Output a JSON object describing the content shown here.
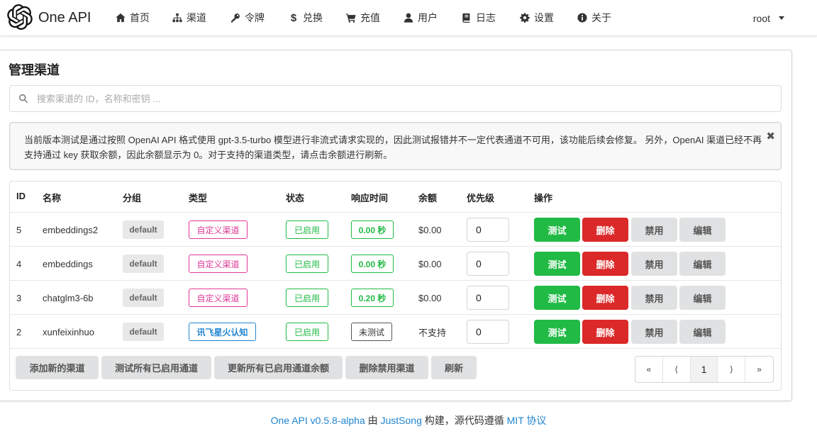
{
  "app": {
    "name": "One API"
  },
  "nav": [
    {
      "label": "首页",
      "icon": "home-icon"
    },
    {
      "label": "渠道",
      "icon": "sitemap-icon"
    },
    {
      "label": "令牌",
      "icon": "key-icon"
    },
    {
      "label": "兑换",
      "icon": "dollar-icon"
    },
    {
      "label": "充值",
      "icon": "cart-icon"
    },
    {
      "label": "用户",
      "icon": "user-icon"
    },
    {
      "label": "日志",
      "icon": "book-icon"
    },
    {
      "label": "设置",
      "icon": "gear-icon"
    },
    {
      "label": "关于",
      "icon": "info-icon"
    }
  ],
  "user": {
    "name": "root"
  },
  "page": {
    "title": "管理渠道"
  },
  "search": {
    "placeholder": "搜索渠道的 ID，名称和密钥 ..."
  },
  "notice": {
    "text": "当前版本测试是通过按照 OpenAI API 格式使用 gpt-3.5-turbo 模型进行非流式请求实现的，因此测试报错并不一定代表通道不可用，该功能后续会修复。 另外，OpenAI 渠道已经不再支持通过 key 获取余额，因此余额显示为 0。对于支持的渠道类型，请点击余额进行刷新。",
    "close": "✖"
  },
  "table": {
    "headers": {
      "id": "ID",
      "name": "名称",
      "group": "分组",
      "type": "类型",
      "status": "状态",
      "response": "响应时间",
      "balance": "余额",
      "priority": "优先级",
      "actions": "操作"
    },
    "rows": [
      {
        "id": "5",
        "name": "embeddings2",
        "group": "default",
        "type": "自定义渠道",
        "type_style": "pink",
        "status": "已启用",
        "response": "0.00 秒",
        "response_style": "green",
        "balance": "$0.00",
        "priority": "0"
      },
      {
        "id": "4",
        "name": "embeddings",
        "group": "default",
        "type": "自定义渠道",
        "type_style": "pink",
        "status": "已启用",
        "response": "0.00 秒",
        "response_style": "green",
        "balance": "$0.00",
        "priority": "0"
      },
      {
        "id": "3",
        "name": "chatglm3-6b",
        "group": "default",
        "type": "自定义渠道",
        "type_style": "pink",
        "status": "已启用",
        "response": "0.20 秒",
        "response_style": "green",
        "balance": "$0.00",
        "priority": "0"
      },
      {
        "id": "2",
        "name": "xunfeixinhuo",
        "group": "default",
        "type": "讯飞星火认知",
        "type_style": "blue",
        "status": "已启用",
        "response": "未测试",
        "response_style": "dark",
        "balance": "不支持",
        "priority": "0"
      }
    ],
    "row_buttons": {
      "test": "测试",
      "delete": "删除",
      "disable": "禁用",
      "edit": "编辑"
    }
  },
  "footer_buttons": {
    "add": "添加新的渠道",
    "test_all": "测试所有已启用通道",
    "update_balance": "更新所有已启用通道余额",
    "delete_disabled": "删除禁用渠道",
    "refresh": "刷新"
  },
  "pagination": {
    "first": "«",
    "prev": "⟨",
    "current": "1",
    "next": "⟩",
    "last": "»"
  },
  "footer": {
    "project": "One API v0.5.8-alpha",
    "by": " 由 ",
    "author": "JustSong",
    "mid": " 构建，源代码遵循 ",
    "license": "MIT 协议"
  }
}
